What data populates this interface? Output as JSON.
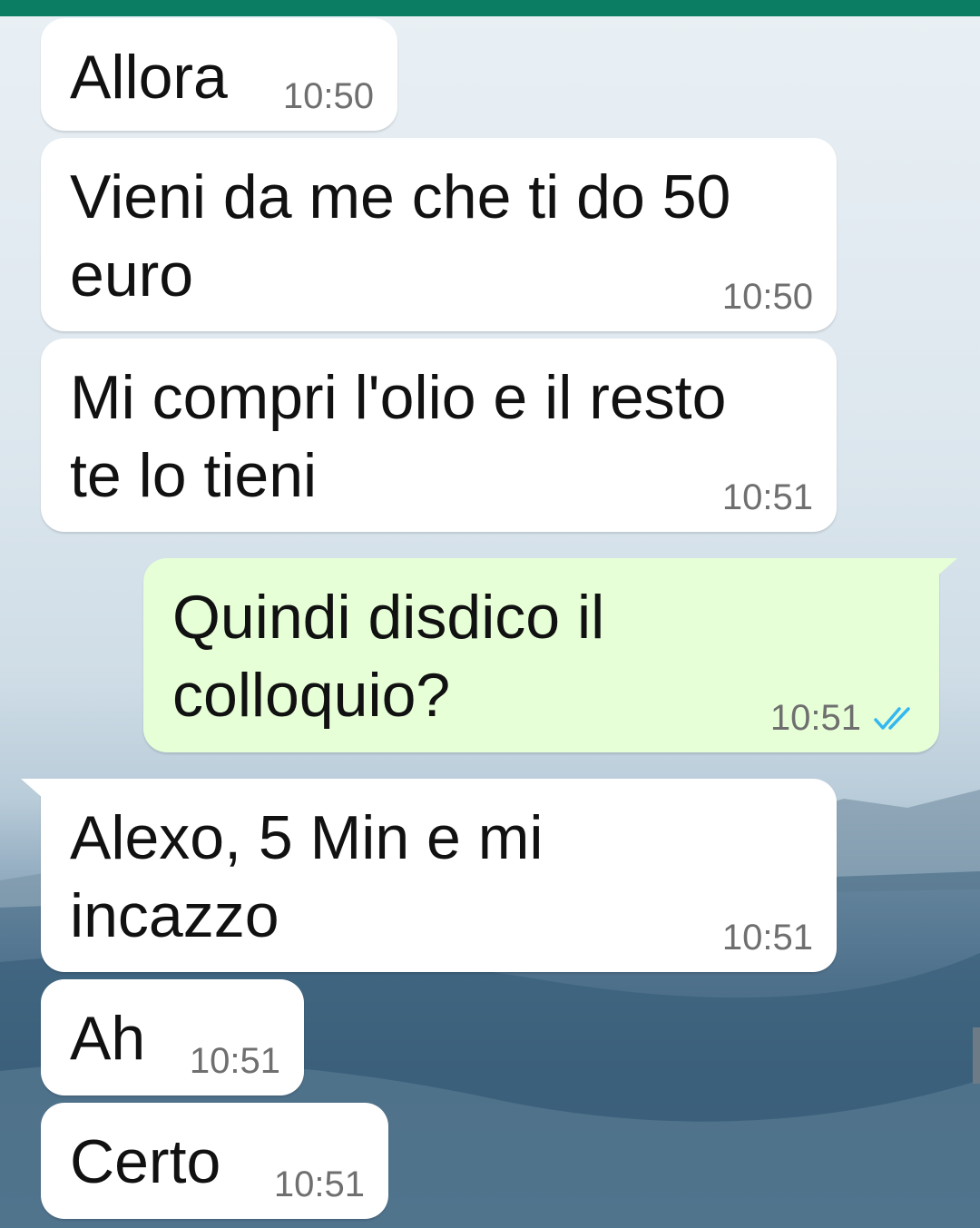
{
  "theme": {
    "header_color": "#0a7d63",
    "incoming_bubble": "#ffffff",
    "outgoing_bubble": "#e6ffd7",
    "read_ticks_color": "#34b7f1"
  },
  "messages": [
    {
      "direction": "incoming",
      "text": "Allora",
      "time": "10:50"
    },
    {
      "direction": "incoming",
      "text": "Vieni da me che ti do 50\neuro",
      "time": "10:50"
    },
    {
      "direction": "incoming",
      "text": "Mi compri l'olio e il resto\nte lo tieni",
      "time": "10:51"
    },
    {
      "direction": "outgoing",
      "text": "Quindi disdico il\ncolloquio?",
      "time": "10:51",
      "status_icon": "double-check-read-icon"
    },
    {
      "direction": "incoming",
      "text": "Alexo, 5 Min e mi\nincazzo",
      "time": "10:51"
    },
    {
      "direction": "incoming",
      "text": "Ah",
      "time": "10:51"
    },
    {
      "direction": "incoming",
      "text": "Certo",
      "time": "10:51"
    }
  ]
}
